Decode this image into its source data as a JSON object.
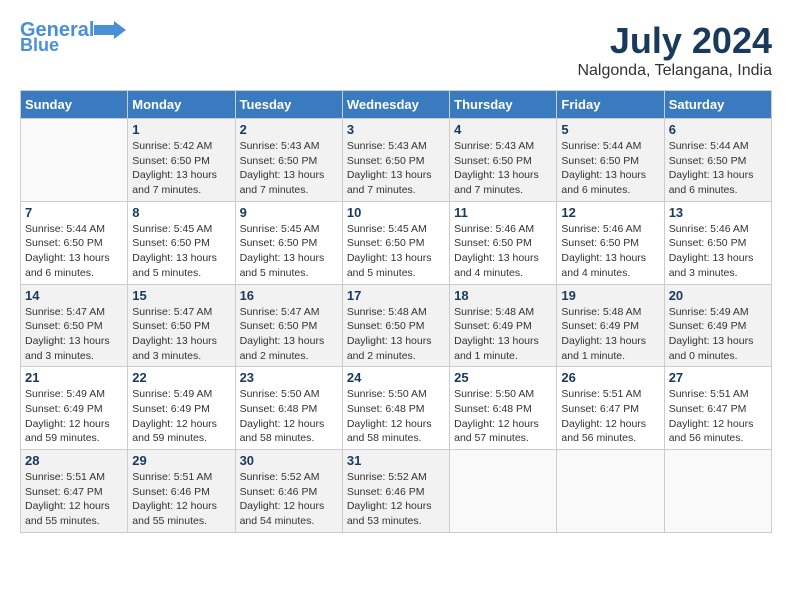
{
  "header": {
    "logo_line1": "General",
    "logo_line2": "Blue",
    "month": "July 2024",
    "location": "Nalgonda, Telangana, India"
  },
  "days_of_week": [
    "Sunday",
    "Monday",
    "Tuesday",
    "Wednesday",
    "Thursday",
    "Friday",
    "Saturday"
  ],
  "weeks": [
    [
      {
        "day": "",
        "info": ""
      },
      {
        "day": "1",
        "info": "Sunrise: 5:42 AM\nSunset: 6:50 PM\nDaylight: 13 hours\nand 7 minutes."
      },
      {
        "day": "2",
        "info": "Sunrise: 5:43 AM\nSunset: 6:50 PM\nDaylight: 13 hours\nand 7 minutes."
      },
      {
        "day": "3",
        "info": "Sunrise: 5:43 AM\nSunset: 6:50 PM\nDaylight: 13 hours\nand 7 minutes."
      },
      {
        "day": "4",
        "info": "Sunrise: 5:43 AM\nSunset: 6:50 PM\nDaylight: 13 hours\nand 7 minutes."
      },
      {
        "day": "5",
        "info": "Sunrise: 5:44 AM\nSunset: 6:50 PM\nDaylight: 13 hours\nand 6 minutes."
      },
      {
        "day": "6",
        "info": "Sunrise: 5:44 AM\nSunset: 6:50 PM\nDaylight: 13 hours\nand 6 minutes."
      }
    ],
    [
      {
        "day": "7",
        "info": "Sunrise: 5:44 AM\nSunset: 6:50 PM\nDaylight: 13 hours\nand 6 minutes."
      },
      {
        "day": "8",
        "info": "Sunrise: 5:45 AM\nSunset: 6:50 PM\nDaylight: 13 hours\nand 5 minutes."
      },
      {
        "day": "9",
        "info": "Sunrise: 5:45 AM\nSunset: 6:50 PM\nDaylight: 13 hours\nand 5 minutes."
      },
      {
        "day": "10",
        "info": "Sunrise: 5:45 AM\nSunset: 6:50 PM\nDaylight: 13 hours\nand 5 minutes."
      },
      {
        "day": "11",
        "info": "Sunrise: 5:46 AM\nSunset: 6:50 PM\nDaylight: 13 hours\nand 4 minutes."
      },
      {
        "day": "12",
        "info": "Sunrise: 5:46 AM\nSunset: 6:50 PM\nDaylight: 13 hours\nand 4 minutes."
      },
      {
        "day": "13",
        "info": "Sunrise: 5:46 AM\nSunset: 6:50 PM\nDaylight: 13 hours\nand 3 minutes."
      }
    ],
    [
      {
        "day": "14",
        "info": "Sunrise: 5:47 AM\nSunset: 6:50 PM\nDaylight: 13 hours\nand 3 minutes."
      },
      {
        "day": "15",
        "info": "Sunrise: 5:47 AM\nSunset: 6:50 PM\nDaylight: 13 hours\nand 3 minutes."
      },
      {
        "day": "16",
        "info": "Sunrise: 5:47 AM\nSunset: 6:50 PM\nDaylight: 13 hours\nand 2 minutes."
      },
      {
        "day": "17",
        "info": "Sunrise: 5:48 AM\nSunset: 6:50 PM\nDaylight: 13 hours\nand 2 minutes."
      },
      {
        "day": "18",
        "info": "Sunrise: 5:48 AM\nSunset: 6:49 PM\nDaylight: 13 hours\nand 1 minute."
      },
      {
        "day": "19",
        "info": "Sunrise: 5:48 AM\nSunset: 6:49 PM\nDaylight: 13 hours\nand 1 minute."
      },
      {
        "day": "20",
        "info": "Sunrise: 5:49 AM\nSunset: 6:49 PM\nDaylight: 13 hours\nand 0 minutes."
      }
    ],
    [
      {
        "day": "21",
        "info": "Sunrise: 5:49 AM\nSunset: 6:49 PM\nDaylight: 12 hours\nand 59 minutes."
      },
      {
        "day": "22",
        "info": "Sunrise: 5:49 AM\nSunset: 6:49 PM\nDaylight: 12 hours\nand 59 minutes."
      },
      {
        "day": "23",
        "info": "Sunrise: 5:50 AM\nSunset: 6:48 PM\nDaylight: 12 hours\nand 58 minutes."
      },
      {
        "day": "24",
        "info": "Sunrise: 5:50 AM\nSunset: 6:48 PM\nDaylight: 12 hours\nand 58 minutes."
      },
      {
        "day": "25",
        "info": "Sunrise: 5:50 AM\nSunset: 6:48 PM\nDaylight: 12 hours\nand 57 minutes."
      },
      {
        "day": "26",
        "info": "Sunrise: 5:51 AM\nSunset: 6:47 PM\nDaylight: 12 hours\nand 56 minutes."
      },
      {
        "day": "27",
        "info": "Sunrise: 5:51 AM\nSunset: 6:47 PM\nDaylight: 12 hours\nand 56 minutes."
      }
    ],
    [
      {
        "day": "28",
        "info": "Sunrise: 5:51 AM\nSunset: 6:47 PM\nDaylight: 12 hours\nand 55 minutes."
      },
      {
        "day": "29",
        "info": "Sunrise: 5:51 AM\nSunset: 6:46 PM\nDaylight: 12 hours\nand 55 minutes."
      },
      {
        "day": "30",
        "info": "Sunrise: 5:52 AM\nSunset: 6:46 PM\nDaylight: 12 hours\nand 54 minutes."
      },
      {
        "day": "31",
        "info": "Sunrise: 5:52 AM\nSunset: 6:46 PM\nDaylight: 12 hours\nand 53 minutes."
      },
      {
        "day": "",
        "info": ""
      },
      {
        "day": "",
        "info": ""
      },
      {
        "day": "",
        "info": ""
      }
    ]
  ]
}
